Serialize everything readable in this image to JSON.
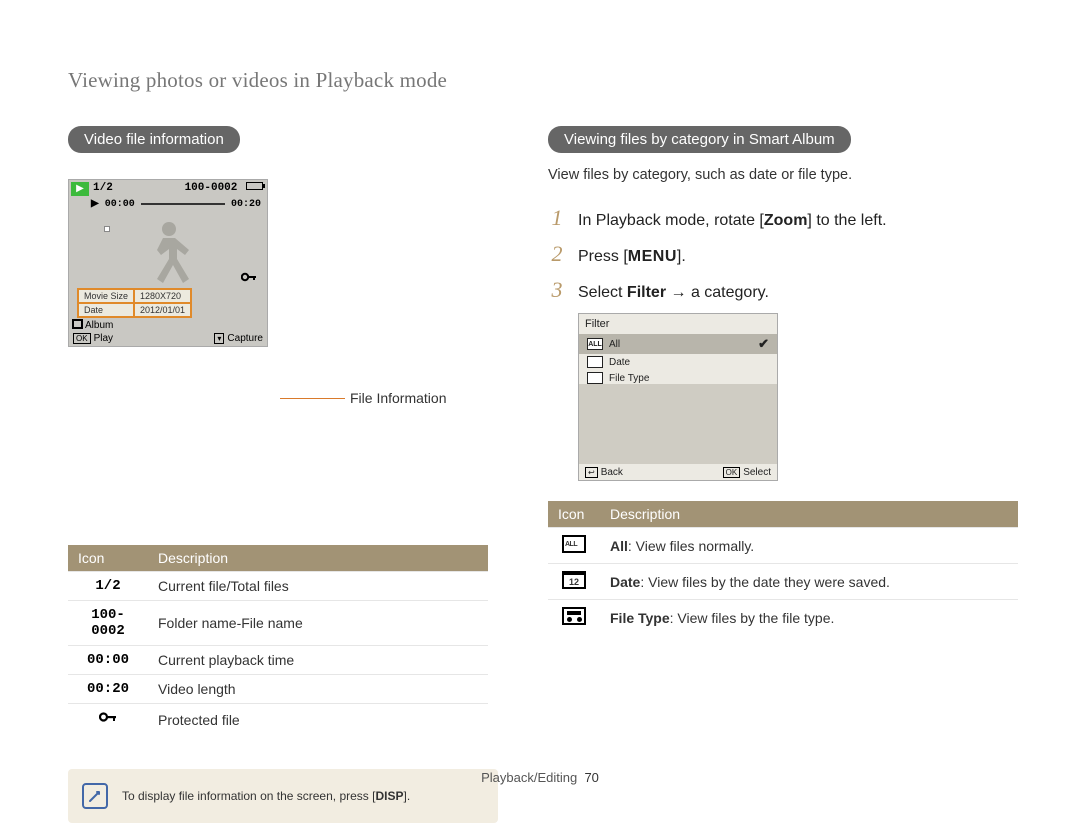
{
  "page_title": "Viewing photos or videos in Playback mode",
  "footer": {
    "section": "Playback/Editing",
    "page": "70"
  },
  "left": {
    "heading": "Video file information",
    "callout": "File Information",
    "lcd": {
      "file_counter": "1/2",
      "folder_file": "100-0002",
      "pb_time_left": "00:00",
      "pb_time_right": "00:20",
      "info_rows": [
        {
          "k": "Movie Size",
          "v": "1280X720"
        },
        {
          "k": "Date",
          "v": "2012/01/01"
        }
      ],
      "album": "Album",
      "play": "Play",
      "capture": "Capture"
    },
    "table_headers": {
      "icon": "Icon",
      "desc": "Description"
    },
    "rows": [
      {
        "icon": "1/2",
        "desc": "Current file/Total files"
      },
      {
        "icon": "100-0002",
        "desc": "Folder name-File name"
      },
      {
        "icon": "00:00",
        "desc": "Current playback time"
      },
      {
        "icon": "00:20",
        "desc": "Video length"
      },
      {
        "icon": "KEY",
        "desc": "Protected file"
      }
    ],
    "note_prefix": "To display file information on the screen, press [",
    "note_button": "DISP",
    "note_suffix": "]."
  },
  "right": {
    "heading": "Viewing files by category in Smart Album",
    "caption": "View files by category, such as date or file type.",
    "steps": [
      {
        "num": "1",
        "pre": "In Playback mode, rotate [",
        "bold": "Zoom",
        "post": "] to the left."
      },
      {
        "num": "2",
        "pre": "Press [",
        "bold": "MENU",
        "post": "]."
      },
      {
        "num": "3",
        "pre": "Select ",
        "bold": "Filter",
        "post": " → a category."
      }
    ],
    "lcd": {
      "title": "Filter",
      "items": [
        {
          "name": "All",
          "selected": true
        },
        {
          "name": "Date",
          "selected": false
        },
        {
          "name": "File Type",
          "selected": false
        }
      ],
      "back": "Back",
      "select": "Select"
    },
    "table_headers": {
      "icon": "Icon",
      "desc": "Description"
    },
    "rows": [
      {
        "key": "all",
        "bold": "All",
        "rest": ": View files normally."
      },
      {
        "key": "date",
        "bold": "Date",
        "rest": ": View files by the date they were saved."
      },
      {
        "key": "ftype",
        "bold": "File Type",
        "rest": ": View files by the file type."
      }
    ]
  }
}
